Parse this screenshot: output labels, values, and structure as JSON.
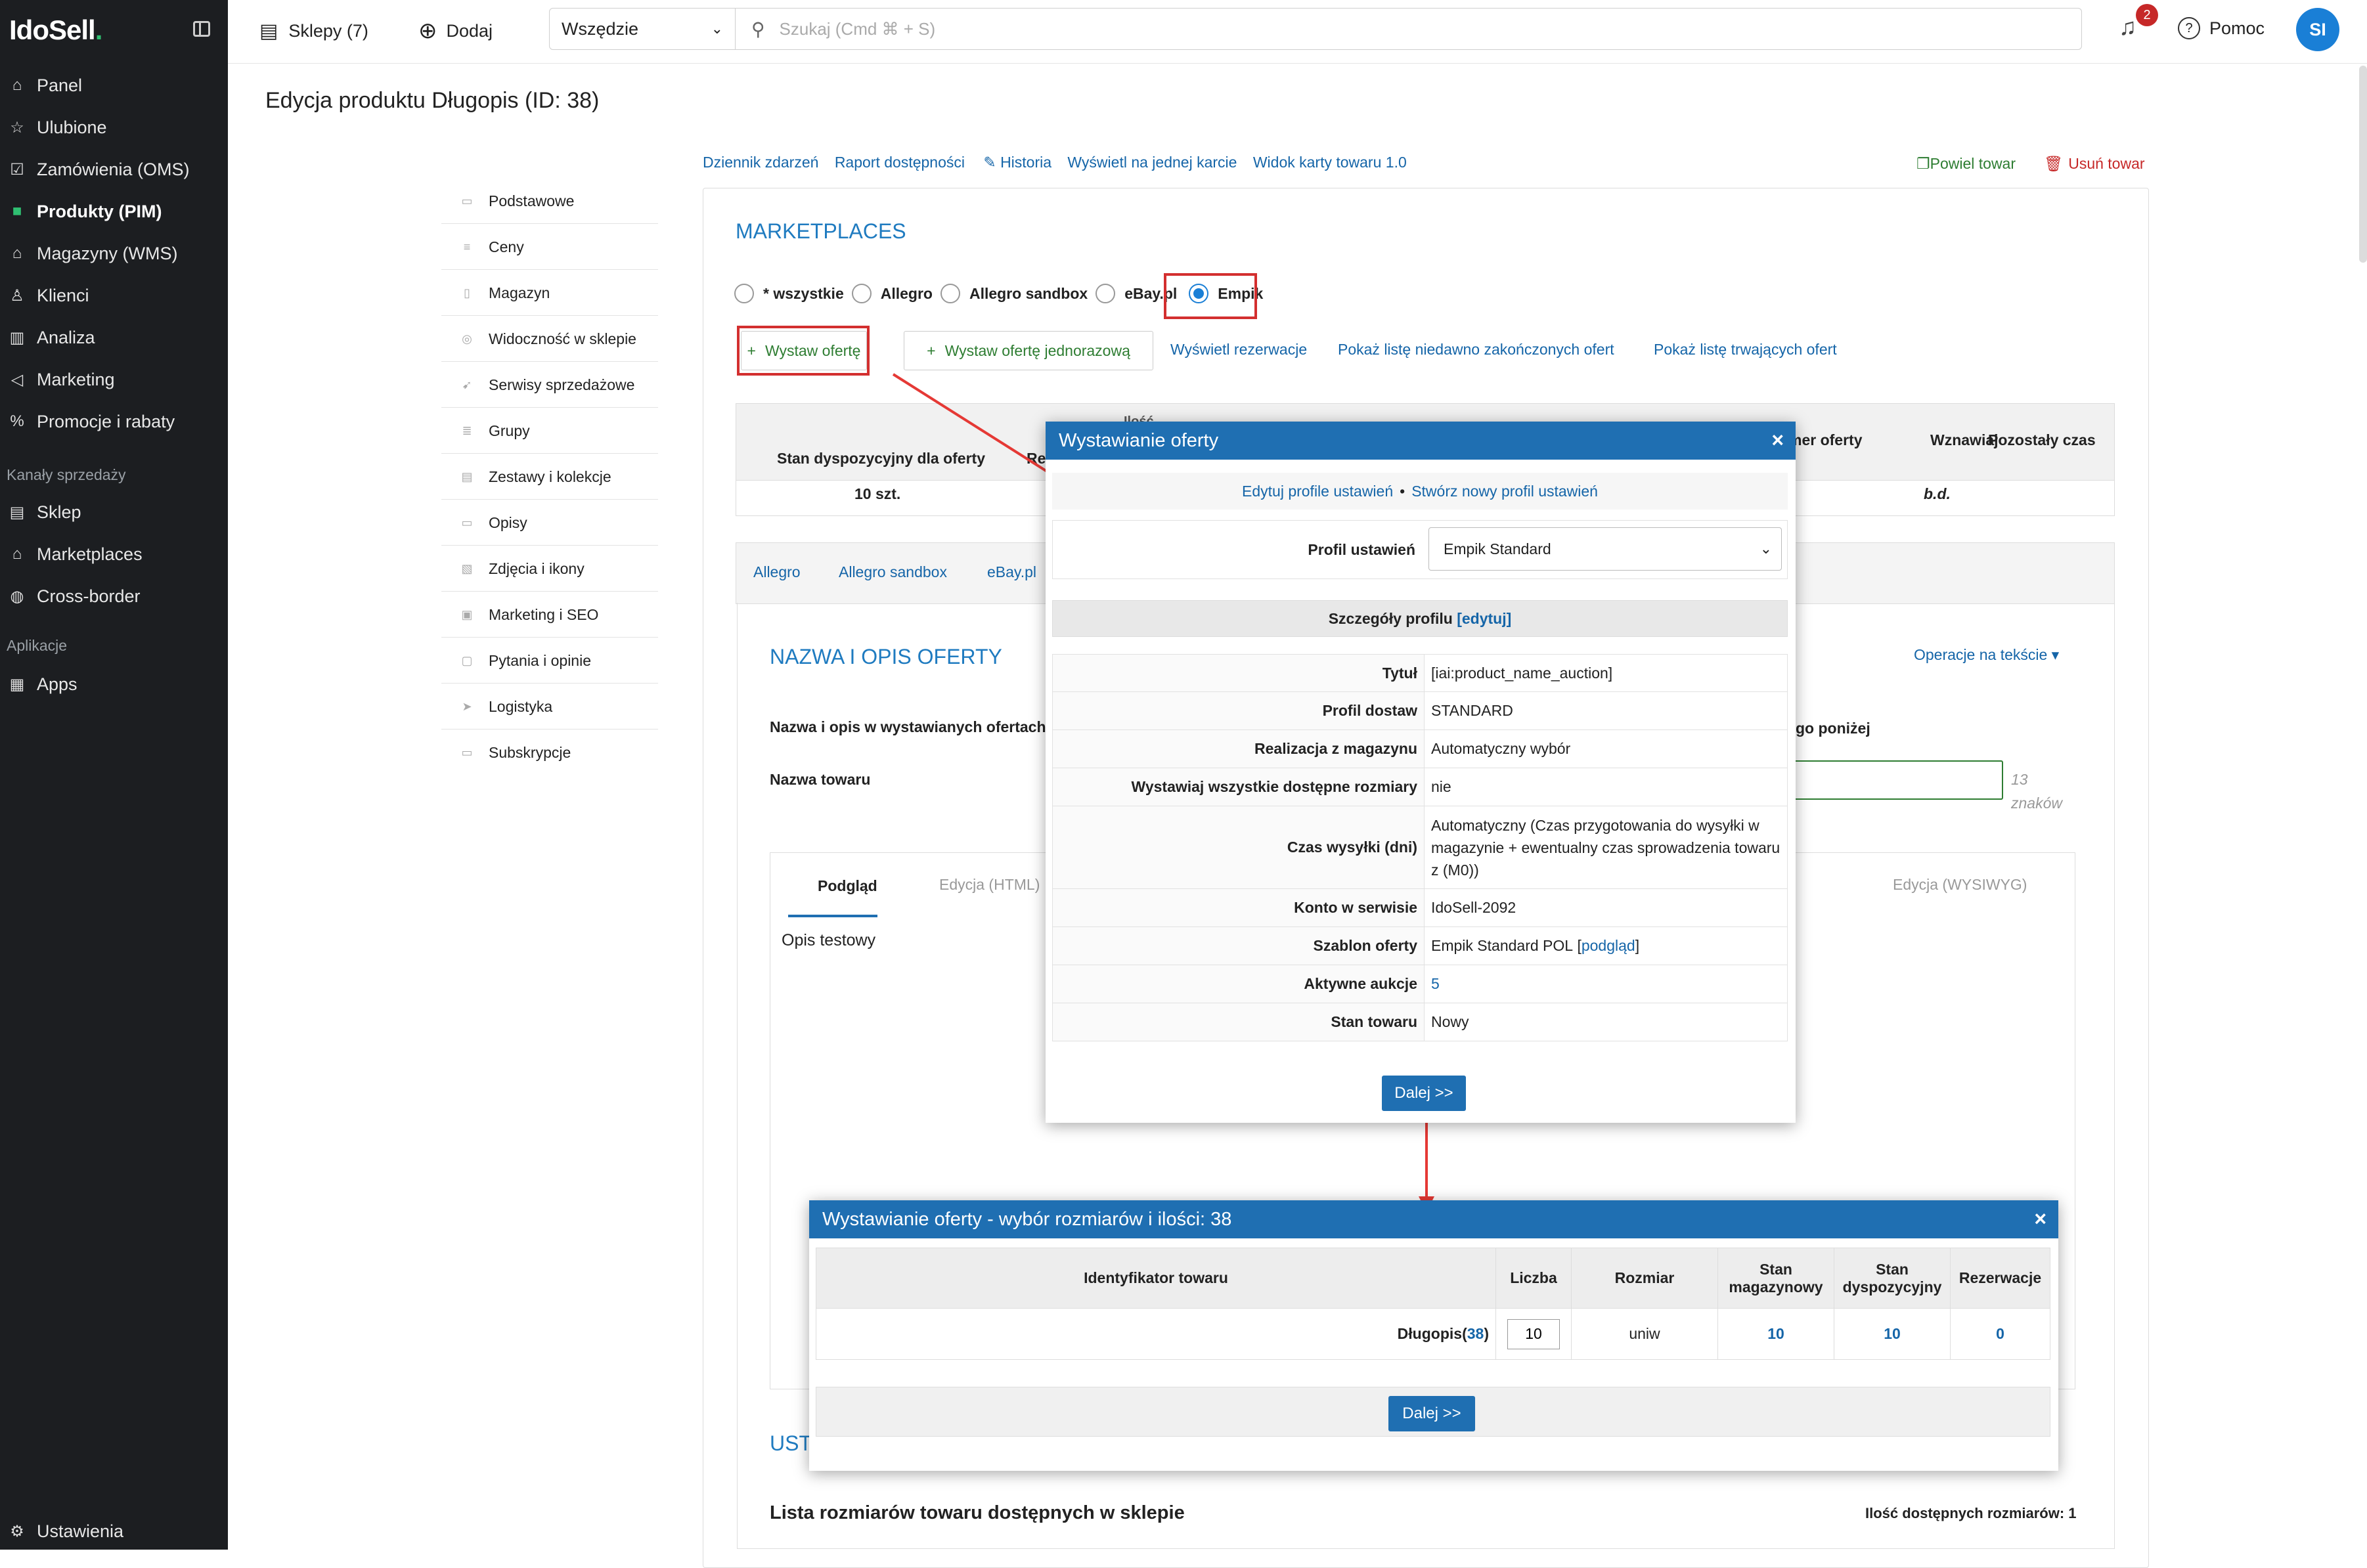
{
  "brand": {
    "logo": "IdoSell",
    "logo_dot": "."
  },
  "sidebar": {
    "items": [
      {
        "label": "Panel",
        "icon": "home-icon"
      },
      {
        "label": "Ulubione",
        "icon": "star-icon"
      },
      {
        "label": "Zamówienia (OMS)",
        "icon": "checkbox-icon"
      },
      {
        "label": "Produkty (PIM)",
        "icon": "box-icon"
      },
      {
        "label": "Magazyny (WMS)",
        "icon": "warehouse-icon"
      },
      {
        "label": "Klienci",
        "icon": "users-icon"
      },
      {
        "label": "Analiza",
        "icon": "bar-chart-icon"
      },
      {
        "label": "Marketing",
        "icon": "megaphone-icon"
      },
      {
        "label": "Promocje i rabaty",
        "icon": "percent-icon"
      }
    ],
    "section_channels": "Kanały sprzedaży",
    "channels": [
      {
        "label": "Sklep",
        "icon": "shop-icon"
      },
      {
        "label": "Marketplaces",
        "icon": "marketplace-icon"
      },
      {
        "label": "Cross-border",
        "icon": "globe-icon"
      }
    ],
    "section_apps": "Aplikacje",
    "apps": [
      {
        "label": "Apps",
        "icon": "grid-icon"
      }
    ],
    "settings": "Ustawienia"
  },
  "topbar": {
    "shops": "Sklepy (7)",
    "add": "Dodaj",
    "scope": "Wszędzie",
    "search_placeholder": "Szukaj (Cmd ⌘ + S)",
    "notifications": "2",
    "help": "Pomoc",
    "avatar": "SI"
  },
  "page": {
    "title": "Edycja produktu Długopis (ID: 38)",
    "links": [
      "Dziennik zdarzeń",
      "Raport dostępności",
      "Historia",
      "Wyświetl na jednej karcie",
      "Widok karty towaru 1.0"
    ],
    "duplicate": "Powiel towar",
    "delete": "Usuń towar"
  },
  "left_menu": [
    "Podstawowe",
    "Ceny",
    "Magazyn",
    "Widoczność w sklepie",
    "Serwisy sprzedażowe",
    "Grupy",
    "Zestawy i kolekcje",
    "Opisy",
    "Zdjęcia i ikony",
    "Marketing i SEO",
    "Pytania i opinie",
    "Logistyka",
    "Subskrypcje"
  ],
  "marketplaces": {
    "heading": "MARKETPLACES",
    "radios": [
      "* wszystkie",
      "Allegro",
      "Allegro sandbox",
      "eBay.pl",
      "Empik"
    ],
    "selected": "Empik",
    "btn_offer": "Wystaw ofertę",
    "btn_offer_once": "Wystaw ofertę jednorazową",
    "link_reservations": "Wyświetl rezerwacje",
    "link_ended": "Pokaż listę niedawno zakończonych ofert",
    "link_active": "Pokaż listę trwających ofert",
    "table": {
      "col_stock": "Stan dyspozycyjny dla oferty",
      "col_qty_partial": "Ilość",
      "col_re": "Re",
      "col_offer_no": "mer oferty",
      "col_resume": "Wznawiaj",
      "col_time": "Pozostały czas",
      "stock_value": "10 szt.",
      "resume_value": "b.d."
    },
    "tabs": [
      "Allegro",
      "Allegro sandbox",
      "eBay.pl"
    ]
  },
  "offer_section": {
    "heading": "NAZWA I OPIS OFERTY",
    "ops": "Operacje na tekście",
    "label_names": "Nazwa i opis w wystawianych ofertach",
    "label_names_tail": "go poniżej",
    "label_product_name": "Nazwa towaru",
    "chars_count": "13",
    "chars_label": "znaków",
    "tab_preview": "Podgląd",
    "tab_html": "Edycja (HTML)",
    "tab_wysiwyg": "Edycja (WYSIWYG)",
    "preview_text": "Opis testowy",
    "ust": "UST",
    "sizes_list": "Lista rozmiarów towaru dostępnych w sklepie",
    "sizes_count": "Ilość dostępnych rozmiarów: 1"
  },
  "modal1": {
    "title": "Wystawianie oferty",
    "edit_profiles": "Edytuj profile ustawień",
    "bullet": "•",
    "new_profile": "Stwórz nowy profil ustawień",
    "profile_label": "Profil ustawień",
    "profile_value": "Empik Standard",
    "details": "Szczegóły profilu",
    "details_edit": "[edytuj]",
    "rows": [
      {
        "k": "Tytuł",
        "v": "[iai:product_name_auction]"
      },
      {
        "k": "Profil dostaw",
        "v": "STANDARD"
      },
      {
        "k": "Realizacja z magazynu",
        "v": "Automatyczny wybór"
      },
      {
        "k": "Wystawiaj wszystkie dostępne rozmiary",
        "v": "nie"
      },
      {
        "k": "Czas wysyłki (dni)",
        "v": "Automatyczny (Czas przygotowania do wysyłki w magazynie + ewentualny czas sprowadzenia towaru z (M0))"
      },
      {
        "k": "Konto w serwisie",
        "v": "IdoSell-2092"
      },
      {
        "k": "Szablon oferty",
        "v": "Empik Standard POL",
        "link": "podgląd"
      },
      {
        "k": "Aktywne aukcje",
        "v": "5"
      },
      {
        "k": "Stan towaru",
        "v": "Nowy"
      }
    ],
    "next": "Dalej >>"
  },
  "modal2": {
    "title": "Wystawianie oferty - wybór rozmiarów i ilości: 38",
    "headers": [
      "Identyfikator towaru",
      "Liczba",
      "Rozmiar",
      "Stan magazynowy",
      "Stan dyspozycyjny",
      "Rezerwacje"
    ],
    "row": {
      "name": "Długopis",
      "id": "38",
      "qty": "10",
      "size": "uniw",
      "stock": "10",
      "available": "10",
      "reserved": "0"
    },
    "next": "Dalej >>"
  },
  "colors": {
    "accent": "#1f6fb2",
    "sidebar": "#1c1e21",
    "green": "#2fbf71",
    "red": "#d32f2f",
    "link": "#1565a8"
  }
}
